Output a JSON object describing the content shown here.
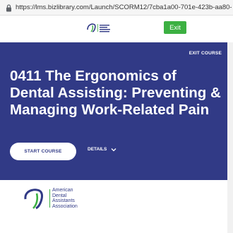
{
  "browser": {
    "url": "https://lms.bizlibrary.com/Launch/SCORM12/7cba1a00-701e-423b-aa80-ff4ffed15669/e..."
  },
  "header": {
    "exit_label": "Exit",
    "accent_color": "#3cb042"
  },
  "hero": {
    "exit_course_label": "EXIT COURSE",
    "title": "0411 The Ergonomics of Dental Assisting: Preventing & Managing Work-Related Pain",
    "start_label": "START COURSE",
    "details_label": "DETAILS",
    "background_color": "#313a86"
  },
  "footer": {
    "org_name": "American\nDental\nAssistants\nAssociation"
  }
}
